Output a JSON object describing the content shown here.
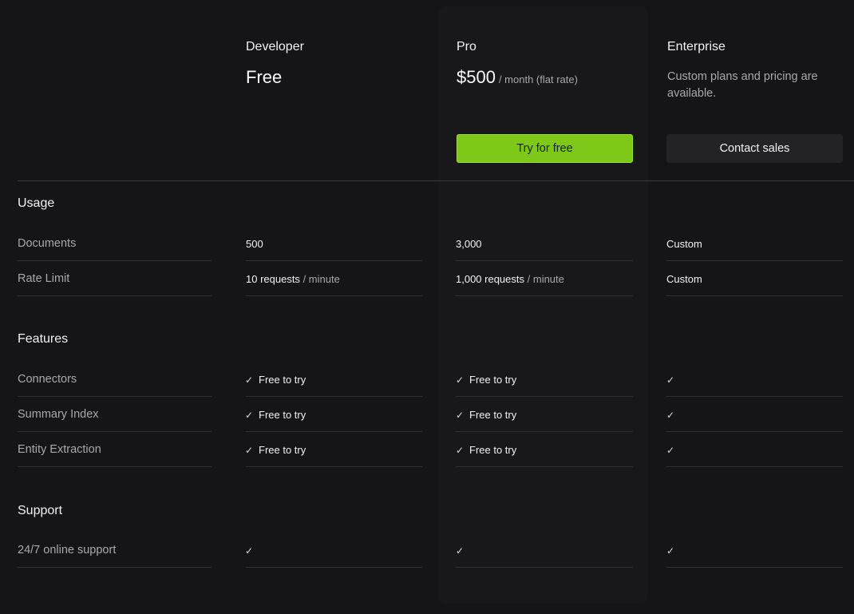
{
  "plans": {
    "developer": {
      "name": "Developer",
      "price": "Free"
    },
    "pro": {
      "name": "Pro",
      "price": "$500",
      "price_unit": "/ month (flat rate)",
      "cta_label": "Try for free"
    },
    "enterprise": {
      "name": "Enterprise",
      "description": "Custom plans and pricing are available.",
      "cta_label": "Contact sales"
    }
  },
  "sections": {
    "usage": {
      "title": "Usage",
      "rows": {
        "documents": {
          "label": "Documents",
          "developer": "500",
          "pro": "3,000",
          "enterprise": "Custom"
        },
        "rate_limit": {
          "label": "Rate Limit",
          "developer": "10 requests",
          "developer_unit": "/ minute",
          "pro": "1,000 requests",
          "pro_unit": "/ minute",
          "enterprise": "Custom"
        }
      }
    },
    "features": {
      "title": "Features",
      "rows": {
        "connectors": {
          "label": "Connectors",
          "developer": "Free to try",
          "pro": "Free to try"
        },
        "summary_index": {
          "label": "Summary Index",
          "developer": "Free to try",
          "pro": "Free to try"
        },
        "entity_extraction": {
          "label": "Entity Extraction",
          "developer": "Free to try",
          "pro": "Free to try"
        }
      }
    },
    "support": {
      "title": "Support",
      "rows": {
        "online_support": {
          "label": "24/7 online support"
        }
      }
    }
  },
  "icons": {
    "check": "✓"
  },
  "colors": {
    "background": "#151517",
    "accent": "#7ec81a",
    "muted_text": "#a8a8ad"
  }
}
